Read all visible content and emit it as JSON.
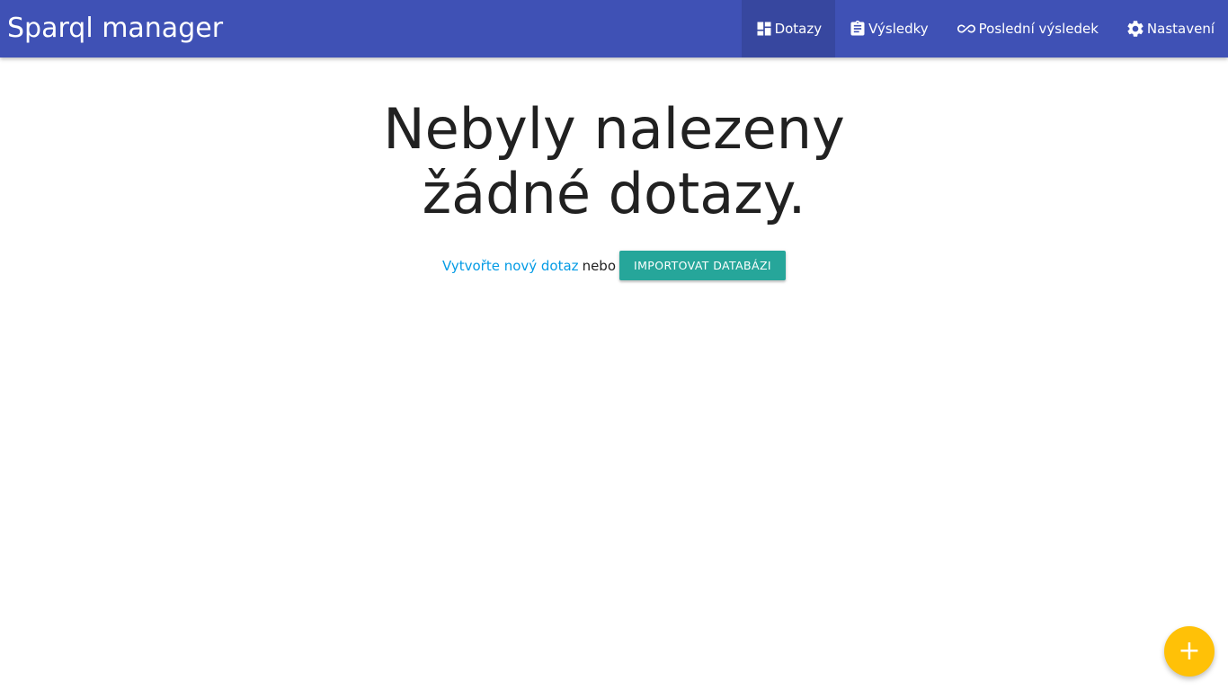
{
  "app": {
    "brand": "Sparql manager"
  },
  "nav": {
    "items": [
      {
        "label": "Dotazy",
        "icon": "dashboard-icon",
        "active": true
      },
      {
        "label": "Výsledky",
        "icon": "clipboard-icon",
        "active": false
      },
      {
        "label": "Poslední výsledek",
        "icon": "infinity-icon",
        "active": false
      },
      {
        "label": "Nastavení",
        "icon": "gear-icon",
        "active": false
      }
    ]
  },
  "main": {
    "headline": "Nebyly nalezeny žádné dotazy.",
    "create_link": "Vytvořte nový dotaz",
    "connector": "nebo",
    "import_button": "IMPORTOVAT DATABÁZI"
  },
  "fab": {
    "label": "+",
    "icon": "add-icon"
  },
  "colors": {
    "primary": "#3f51b5",
    "accent_button": "#26a69a",
    "link": "#039be5",
    "fab": "#ffc107"
  }
}
